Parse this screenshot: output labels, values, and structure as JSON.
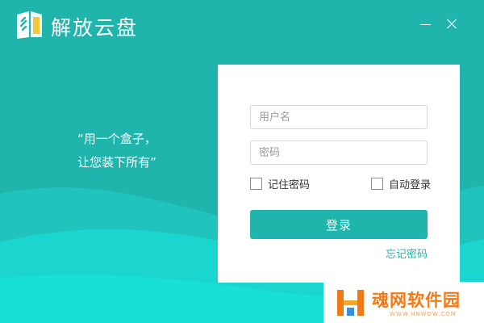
{
  "window": {
    "title": "解放云盘",
    "minimize_icon": "minimize-icon",
    "close_icon": "close-icon"
  },
  "slogan": {
    "line1": "“用一个盒子，",
    "line2": "让您装下所有”"
  },
  "login": {
    "username_placeholder": "用户名",
    "username_value": "",
    "password_placeholder": "密码",
    "password_value": "",
    "remember_password_label": "记住密码",
    "remember_password_checked": false,
    "auto_login_label": "自动登录",
    "auto_login_checked": false,
    "login_button_label": "登录",
    "forgot_password_label": "忘记密码"
  },
  "watermark": {
    "title": "魂网软件园",
    "url": "WWW.HNWDW.COM"
  },
  "colors": {
    "primary": "#1fb5ad",
    "wave_light": "#20c8c0",
    "wave_lighter": "#1cdcd4",
    "watermark_orange": "#f07a15"
  }
}
